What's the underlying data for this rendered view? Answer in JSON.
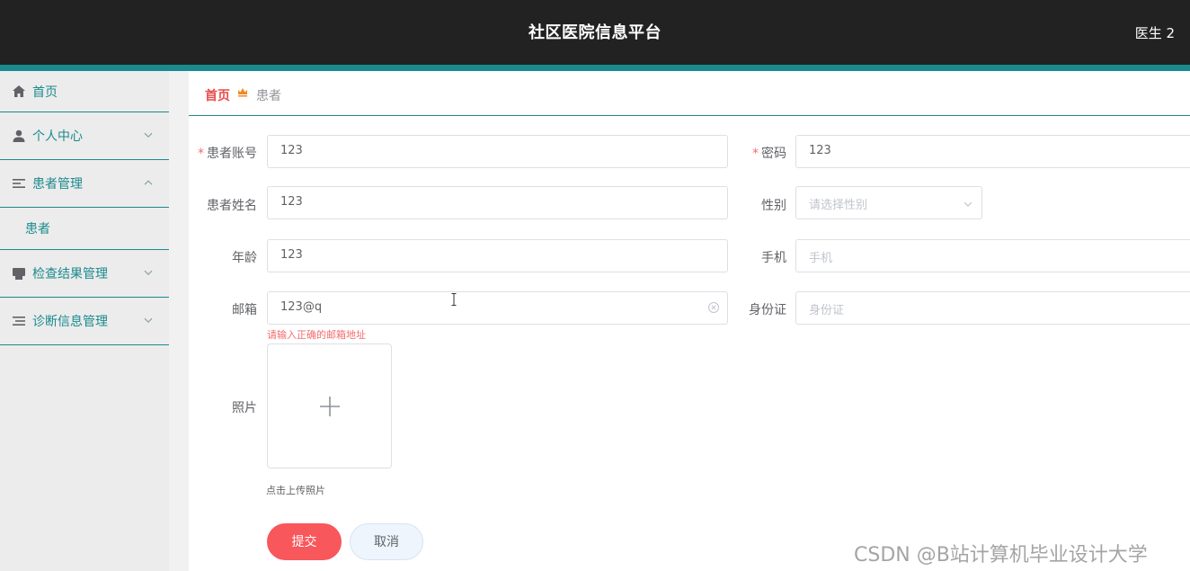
{
  "header": {
    "title": "社区医院信息平台",
    "user": "医生 2"
  },
  "sidebar": {
    "items": [
      {
        "label": "首页",
        "icon": "home-icon"
      },
      {
        "label": "个人中心",
        "icon": "user-icon"
      },
      {
        "label": "患者管理",
        "icon": "list-icon",
        "expanded": true
      },
      {
        "label": "患者"
      },
      {
        "label": "检查结果管理",
        "icon": "printer-icon"
      },
      {
        "label": "诊断信息管理",
        "icon": "list-icon"
      }
    ]
  },
  "breadcrumb": {
    "home": "首页",
    "current": "患者"
  },
  "form": {
    "account": {
      "label": "患者账号",
      "value": "123",
      "required": true
    },
    "password": {
      "label": "密码",
      "value": "123",
      "required": true
    },
    "name": {
      "label": "患者姓名",
      "value": "123"
    },
    "gender": {
      "label": "性别",
      "placeholder": "请选择性别"
    },
    "age": {
      "label": "年龄",
      "value": "123"
    },
    "phone": {
      "label": "手机",
      "placeholder": "手机"
    },
    "email": {
      "label": "邮箱",
      "value": "123@q",
      "error": "请输入正确的邮箱地址"
    },
    "idcard": {
      "label": "身份证",
      "placeholder": "身份证"
    },
    "photo": {
      "label": "照片",
      "tip": "点击上传照片"
    },
    "submit": "提交",
    "cancel": "取消"
  },
  "watermark": "CSDN @B站计算机毕业设计大学",
  "colors": {
    "header": "#222222",
    "accent": "#1b8a8d",
    "danger": "#f8575c",
    "sidebar_bg": "#ececec"
  }
}
